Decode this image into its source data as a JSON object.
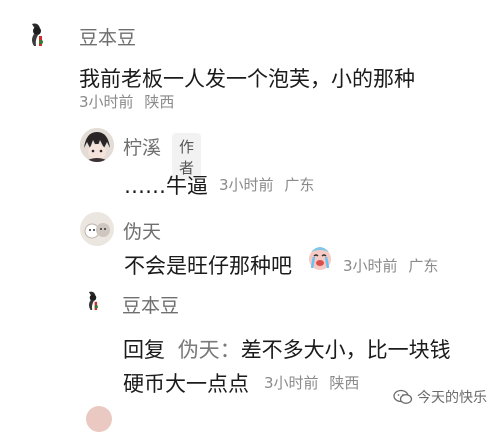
{
  "comments": [
    {
      "user": "豆本豆",
      "text": "我前老板一人发一个泡芙，小的那种",
      "time": "3小时前",
      "location": "陕西"
    },
    {
      "user": "柠溪",
      "badge": "作者",
      "text": "……牛逼",
      "time": "3小时前",
      "location": "广东"
    },
    {
      "user": "伪天",
      "text": "不会是旺仔那种吧",
      "emoji": "crying-face-emoji",
      "time": "3小时前",
      "location": "广东"
    },
    {
      "user": "豆本豆",
      "reply_prefix": "回复",
      "reply_to": "伪天",
      "reply_sep": "：",
      "text_line1": "差不多大小，比一块钱",
      "text_line2": "硬币大一点点",
      "time": "3小时前",
      "location": "陕西"
    }
  ],
  "watermark": {
    "text": "今天的快乐",
    "icon": "wechat-icon"
  },
  "colors": {
    "name": "#6f6f6f",
    "meta": "#8a8a8a",
    "text": "#1b1b1b"
  }
}
